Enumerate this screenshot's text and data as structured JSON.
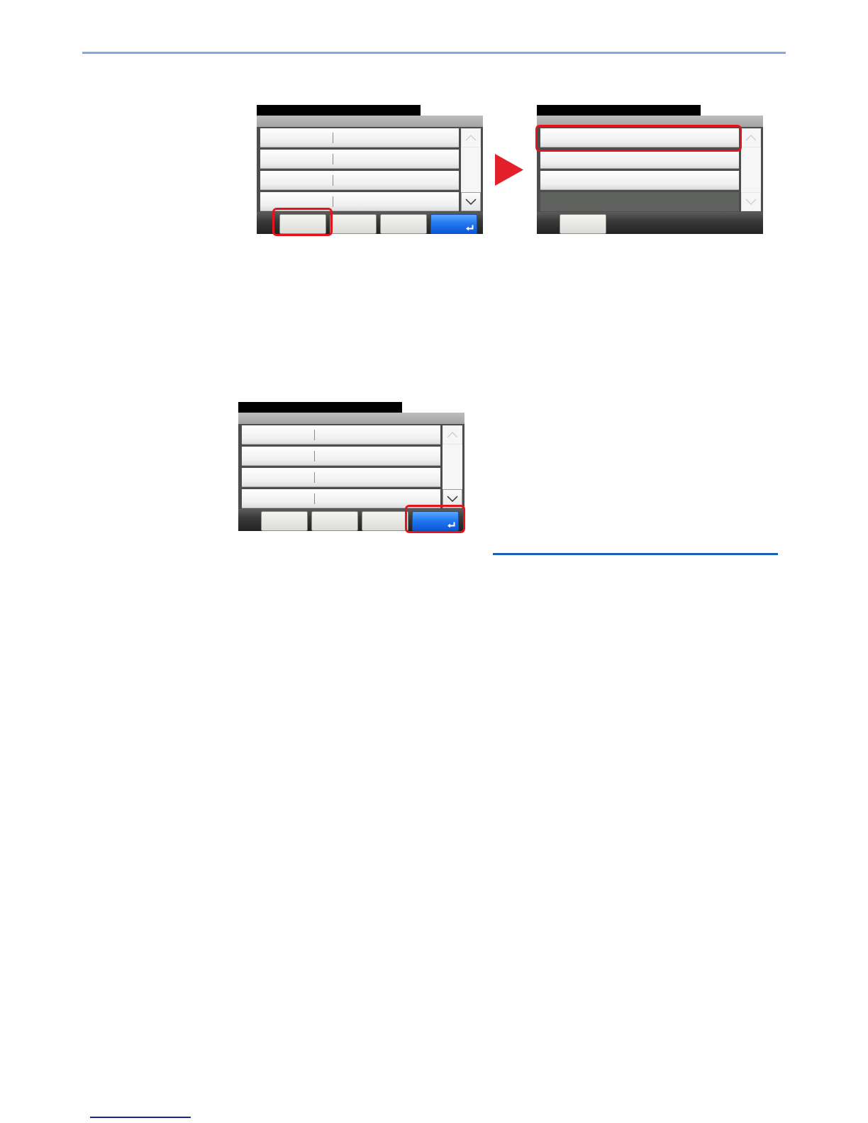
{
  "figures": [
    {
      "screens": [
        {
          "rows": [
            {
              "kind": "split",
              "highlighted": false
            },
            {
              "kind": "split",
              "highlighted": false
            },
            {
              "kind": "split",
              "highlighted": false
            },
            {
              "kind": "split",
              "highlighted": false
            }
          ],
          "scroll_buttons": [
            {
              "kind": "up",
              "disabled": true
            },
            {
              "kind": "down",
              "disabled": false
            }
          ],
          "soft_keys": [
            {
              "kind": "plain",
              "highlighted": true
            },
            {
              "kind": "plain",
              "highlighted": false
            },
            {
              "kind": "plain",
              "highlighted": false
            },
            {
              "kind": "enter",
              "highlighted": false
            }
          ]
        },
        {
          "rows": [
            {
              "kind": "plain",
              "highlighted": true
            },
            {
              "kind": "plain",
              "highlighted": false
            },
            {
              "kind": "plain",
              "highlighted": false
            },
            {
              "kind": "empty",
              "highlighted": false
            }
          ],
          "scroll_buttons": [
            {
              "kind": "up",
              "disabled": true
            },
            {
              "kind": "down",
              "disabled": true
            }
          ],
          "soft_keys": [
            {
              "kind": "plain",
              "highlighted": false
            }
          ]
        }
      ]
    },
    {
      "screens": [
        {
          "rows": [
            {
              "kind": "split",
              "highlighted": false
            },
            {
              "kind": "split",
              "highlighted": false
            },
            {
              "kind": "split",
              "highlighted": false
            },
            {
              "kind": "split",
              "highlighted": false
            }
          ],
          "scroll_buttons": [
            {
              "kind": "up",
              "disabled": true
            },
            {
              "kind": "down",
              "disabled": false
            }
          ],
          "soft_keys": [
            {
              "kind": "plain",
              "highlighted": false
            },
            {
              "kind": "plain",
              "highlighted": false
            },
            {
              "kind": "plain",
              "highlighted": false
            },
            {
              "kind": "enter",
              "highlighted": true
            }
          ]
        }
      ]
    }
  ]
}
